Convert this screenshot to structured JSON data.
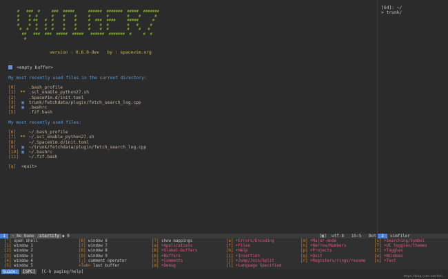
{
  "logo_text": "   #   ###  #     ###  #####      ######  #######  #####  #######\n   #    #  #      #    #    #     #       #        #    #      #\n   #    # ##   #  #    #    #     #  ###  ####     #####      #\n   #    #  #   #  #    #    #     #    #  #        #   #     #\n    #  #   #   #  #    #    #     #    #  #        #    #   #\n     ##   ###  ###  #####  #####   ######  #######  #     #  #\n      #",
  "version_line": "version : 0.6.0-dev   by : spacevim.org",
  "empty_buffer": "<empty buffer>",
  "dir_header": "My most recently used files in the current directory:",
  "dir_files": [
    {
      "idx": "[0]",
      "icon": "",
      "path": ".bash_profile"
    },
    {
      "idx": "[1]",
      "icon": "**",
      "path": ".scl_enable_python27.sh"
    },
    {
      "idx": "[2]",
      "icon": "",
      "path": ".SpaceVim.d/init.toml"
    },
    {
      "idx": "[3]",
      "icon": "▣",
      "path": "trunk/fetchdata/plugin/fetch_search_log.cpp"
    },
    {
      "idx": "[4]",
      "icon": "▣",
      "path": ".bashrc"
    },
    {
      "idx": "[5]",
      "icon": "",
      "path": ".fzf.bash"
    }
  ],
  "mru_header": "My most recently used files:",
  "mru_files": [
    {
      "idx": "[6]",
      "icon": "",
      "path": "~/.bash_profile"
    },
    {
      "idx": "[7]",
      "icon": "**",
      "path": "~/.scl_enable_python27.sh"
    },
    {
      "idx": "[8]",
      "icon": "",
      "path": "~/.SpaceVim.d/init.toml"
    },
    {
      "idx": "[9]",
      "icon": "▣",
      "path": "~/trunk/fetchdata/plugin/fetch_search_log.cpp"
    },
    {
      "idx": "[10]",
      "icon": "▣",
      "path": "~/.bashrc"
    },
    {
      "idx": "[11]",
      "icon": "",
      "path": "~/.fzf.bash"
    }
  ],
  "quit_idx": "[q]",
  "quit_label": "<quit>",
  "side": {
    "line1": "[Gd]: ~/",
    "line2": "> trunk/"
  },
  "status": {
    "num": "1",
    "name": "~ No Name",
    "filetype": "startify",
    "warn": "◆ 0",
    "right": "[▣]  utf-8   15:5   Bot",
    "vf_num": "2",
    "vf_name": "vimfiler"
  },
  "guide_cols": [
    [
      {
        "k": "[\"]",
        "t": "open shell",
        "g": false
      },
      {
        "k": "[1]",
        "t": "window 1",
        "g": false
      },
      {
        "k": "[2]",
        "t": "window 2",
        "g": false
      },
      {
        "k": "[3]",
        "t": "window 3",
        "g": false
      },
      {
        "k": "[4]",
        "t": "window 4",
        "g": false
      },
      {
        "k": "[5]",
        "t": "window 5",
        "g": false
      }
    ],
    [
      {
        "k": "[6]",
        "t": "window 6",
        "g": false
      },
      {
        "k": "[7]",
        "t": "window 7",
        "g": false
      },
      {
        "k": "[8]",
        "t": "window 8",
        "g": false
      },
      {
        "k": "[9]",
        "t": "window 9",
        "g": false
      },
      {
        "k": "[;]",
        "t": "comment operator",
        "g": false
      },
      {
        "k": "<Tab>",
        "t": "last buffer",
        "g": false
      }
    ],
    [
      {
        "k": "[?]",
        "t": "show mappings",
        "g": false
      },
      {
        "k": "[a]",
        "t": "+Applications",
        "g": true
      },
      {
        "k": "[B]",
        "t": "+Global-buffers",
        "g": true
      },
      {
        "k": "[b]",
        "t": "+Buffers",
        "g": true
      },
      {
        "k": "[c]",
        "t": "+Comments",
        "g": true
      },
      {
        "k": "[d]",
        "t": "+Debug",
        "g": true
      }
    ],
    [
      {
        "k": "[e]",
        "t": "+Errors/Encoding",
        "g": true
      },
      {
        "k": "[f]",
        "t": "+Files",
        "g": true
      },
      {
        "k": "[h]",
        "t": "+Help",
        "g": true
      },
      {
        "k": "[i]",
        "t": "+Insertion",
        "g": true
      },
      {
        "k": "[j]",
        "t": "+Jump/Join/Split",
        "g": true
      },
      {
        "k": "[l]",
        "t": "+Language Specified",
        "g": true
      }
    ],
    [
      {
        "k": "[m]",
        "t": "+Major-mode",
        "g": true
      },
      {
        "k": "[n]",
        "t": "+Narrow/Numbers",
        "g": true
      },
      {
        "k": "[p]",
        "t": "+Projects",
        "g": true
      },
      {
        "k": "[q]",
        "t": "+Quit",
        "g": true
      },
      {
        "k": "[r]",
        "t": "+Registers/rings/resume",
        "g": true
      }
    ],
    [
      {
        "k": "[s]",
        "t": "+Searching/Symbol",
        "g": true
      },
      {
        "k": "[T]",
        "t": "+UI toggles/themes",
        "g": true
      },
      {
        "k": "[t]",
        "t": "+Toggles",
        "g": true
      },
      {
        "k": "[w]",
        "t": "+Windows",
        "g": true
      },
      {
        "k": "[x]",
        "t": "+Text",
        "g": true
      }
    ]
  ],
  "guide_bar": {
    "label": "Guide:",
    "key": "[SPC]",
    "hint": "[C-h paging/help]"
  },
  "watermark": "https://blog.csdn.net/deli..."
}
